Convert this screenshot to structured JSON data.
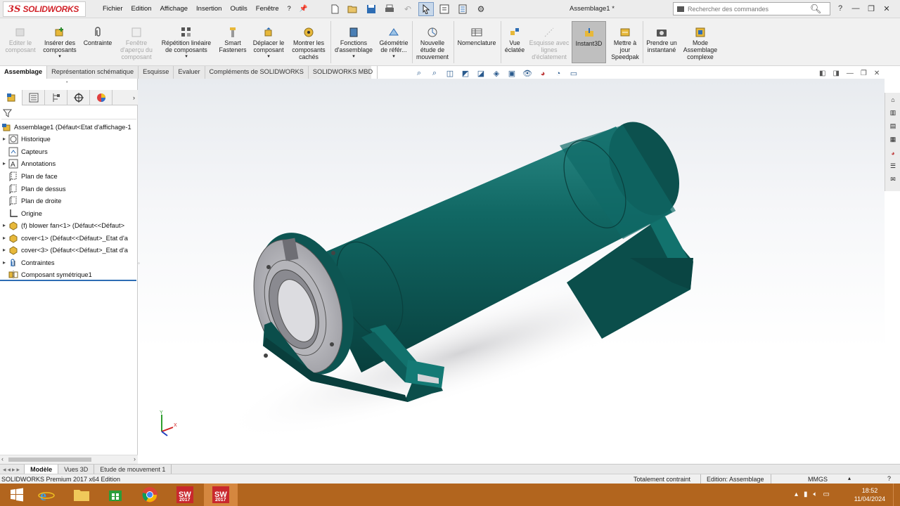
{
  "app": {
    "brand_ds": "3S",
    "brand_name": "SOLIDWORKS",
    "document_title": "Assemblage1 *"
  },
  "menu": [
    "Fichier",
    "Edition",
    "Affichage",
    "Insertion",
    "Outils",
    "Fenêtre",
    "?"
  ],
  "search": {
    "placeholder": "Rechercher des commandes"
  },
  "ribbon": {
    "buttons": [
      {
        "label": "Editer le composant"
      },
      {
        "label": "Insérer des composants"
      },
      {
        "label": "Contrainte"
      },
      {
        "label": "Fenêtre d'aperçu du composant"
      },
      {
        "label": "Répétition linéaire de composants"
      },
      {
        "label": "Smart Fasteners"
      },
      {
        "label": "Déplacer le composant"
      },
      {
        "label": "Montrer les composants cachés"
      },
      {
        "label": "Fonctions d'assemblage"
      },
      {
        "label": "Géométrie de référ..."
      },
      {
        "label": "Nouvelle étude de mouvement"
      },
      {
        "label": "Nomenclature"
      },
      {
        "label": "Vue éclatée"
      },
      {
        "label": "Esquisse avec lignes d'éclatement"
      },
      {
        "label": "Instant3D"
      },
      {
        "label": "Mettre à jour Speedpak"
      },
      {
        "label": "Prendre un instantané"
      },
      {
        "label": "Mode Assemblage complexe"
      }
    ]
  },
  "command_tabs": [
    "Assemblage",
    "Représentation schématique",
    "Esquisse",
    "Evaluer",
    "Compléments de SOLIDWORKS",
    "SOLIDWORKS MBD"
  ],
  "feature_tree": {
    "root": "Assemblage1  (Défaut<Etat d'affichage-1",
    "items": [
      {
        "label": "Historique",
        "expandable": true
      },
      {
        "label": "Capteurs",
        "expandable": false
      },
      {
        "label": "Annotations",
        "expandable": true
      },
      {
        "label": "Plan de face",
        "expandable": false
      },
      {
        "label": "Plan de dessus",
        "expandable": false
      },
      {
        "label": "Plan de droite",
        "expandable": false
      },
      {
        "label": "Origine",
        "expandable": false
      },
      {
        "label": "(f) blower fan<1> (Défaut<<Défaut>",
        "expandable": true
      },
      {
        "label": "cover<1> (Défaut<<Défaut>_Etat d'a",
        "expandable": true
      },
      {
        "label": "cover<3> (Défaut<<Défaut>_Etat d'a",
        "expandable": true
      },
      {
        "label": "Contraintes",
        "expandable": true
      },
      {
        "label": "Composant symétrique1",
        "expandable": false
      }
    ]
  },
  "bottom_tabs": [
    "Modèle",
    "Vues 3D",
    "Etude de mouvement 1"
  ],
  "status": {
    "edition": "SOLIDWORKS Premium 2017 x64 Edition",
    "constraint": "Totalement contraint",
    "mode": "Edition: Assemblage",
    "units": "MMGS"
  },
  "taskbar": {
    "time": "18:52",
    "date": "11/04/2024",
    "sw_badge": "2017"
  },
  "triad": {
    "y": "Y",
    "x": "X"
  },
  "colors": {
    "model": "#0f5f5c",
    "model_dark": "#0a4745",
    "steel": "#b8b8bc",
    "brand_red": "#d2232a",
    "taskbar": "#b2651e"
  }
}
